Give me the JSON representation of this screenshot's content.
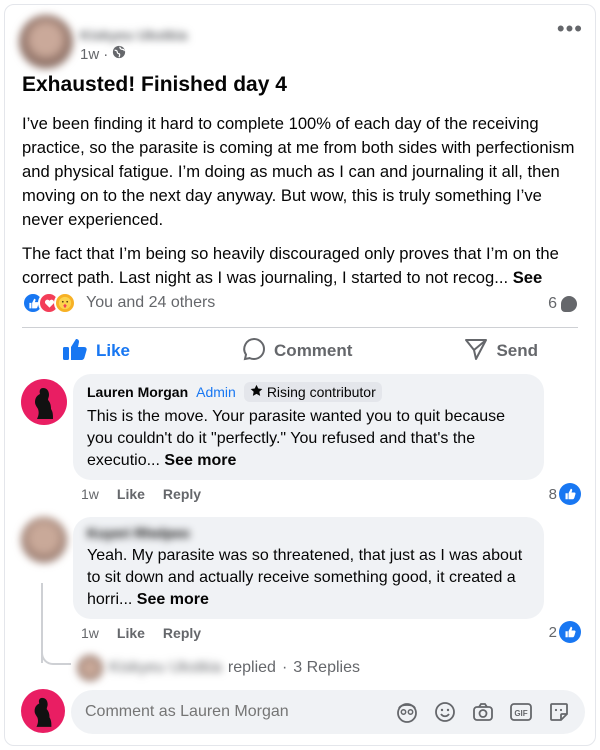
{
  "post": {
    "author": "Kiskyeu Ukstkia",
    "time": "1w",
    "privacy_icon": "globe-icon",
    "title": "Exhausted! Finished day 4",
    "paragraph1": "I’ve been finding it hard to complete 100% of each day of the receiving practice, so the parasite is coming at me from both sides with perfectionism and physical fatigue. I’m doing as much as I can and journaling it all, then moving on to the next day anyway. But wow, this is truly something I’ve never experienced.",
    "paragraph2": "The fact that I’m being so heavily discouraged only proves that I’m on the correct path. Last night as I was journaling, I started to not recog...",
    "see_more": "See more"
  },
  "reactions": {
    "summary": "You and 24 others",
    "comment_count": "6",
    "types": [
      "like",
      "love",
      "care"
    ]
  },
  "actions": {
    "like": "Like",
    "comment": "Comment",
    "send": "Send"
  },
  "comments": [
    {
      "author": "Lauren Morgan",
      "role": "Admin",
      "badge": "Rising contributor",
      "text": "This is the move. Your parasite wanted you to quit because you couldn't do it \"perfectly.\"  You refused and that's the executio...",
      "see_more": "See more",
      "time": "1w",
      "like_label": "Like",
      "reply_label": "Reply",
      "likes": "8"
    },
    {
      "author": "Kuyeri Rhelpeo",
      "text": "Yeah. My parasite was so threatened, that just as I was about to sit down and actually receive something good, it created a horri...",
      "see_more": "See more",
      "time": "1w",
      "like_label": "Like",
      "reply_label": "Reply",
      "likes": "2"
    }
  ],
  "replies": {
    "author": "Kiskyeu Ukstkia",
    "label": "replied",
    "count": "3 Replies"
  },
  "composer": {
    "placeholder": "Comment as Lauren Morgan"
  },
  "colors": {
    "accent": "#1877f2",
    "text": "#050505",
    "secondary": "#65676b",
    "bubble": "#f0f2f5",
    "avatar_pink": "#e91e63"
  }
}
